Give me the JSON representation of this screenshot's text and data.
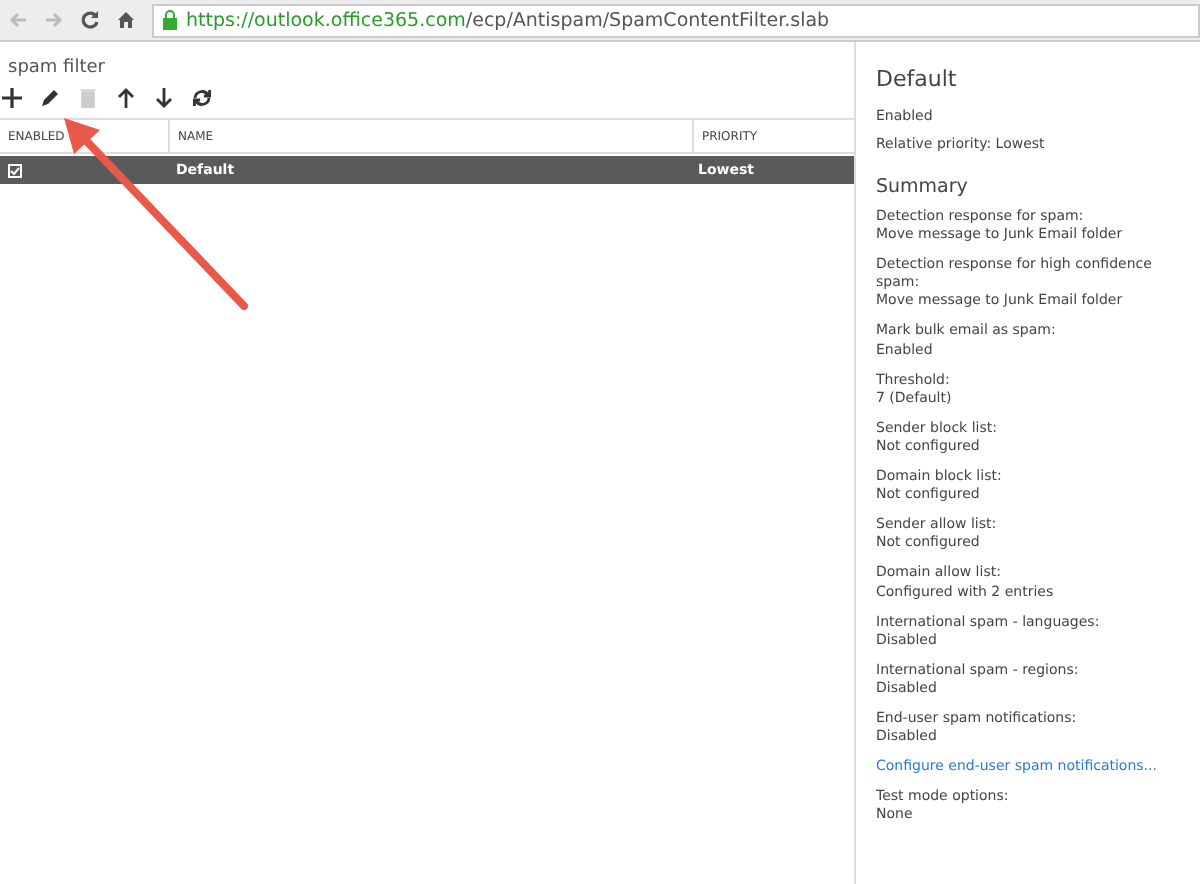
{
  "browser": {
    "url_host": "https://outlook.office365.com",
    "url_path": "/ecp/Antispam/SpamContentFilter.slab"
  },
  "page_title": "spam filter",
  "toolbar": [
    {
      "kind": "add",
      "disabled": false
    },
    {
      "kind": "edit",
      "disabled": false
    },
    {
      "kind": "delete",
      "disabled": true
    },
    {
      "kind": "up",
      "disabled": false
    },
    {
      "kind": "down",
      "disabled": false
    },
    {
      "kind": "refresh",
      "disabled": false
    }
  ],
  "table": {
    "columns": [
      "ENABLED",
      "NAME",
      "PRIORITY"
    ],
    "rows": [
      {
        "enabled": true,
        "name": "Default",
        "priority": "Lowest",
        "selected": true
      }
    ]
  },
  "details": {
    "title": "Default",
    "status": "Enabled",
    "priority": "Relative priority: Lowest",
    "summary_title": "Summary",
    "items": [
      {
        "kind": "field",
        "label": "Detection response for spam:",
        "value": "Move message to Junk Email folder"
      },
      {
        "kind": "field",
        "label": "Detection response for high confidence spam:",
        "value": "Move message to Junk Email folder"
      },
      {
        "kind": "field",
        "label": "Mark bulk email as spam:",
        "value": "Enabled"
      },
      {
        "kind": "field",
        "label": "Threshold:",
        "value": "7 (Default)"
      },
      {
        "kind": "field",
        "label": "Sender block list:",
        "value": "Not configured"
      },
      {
        "kind": "field",
        "label": "Domain block list:",
        "value": "Not configured"
      },
      {
        "kind": "field",
        "label": "Sender allow list:",
        "value": "Not configured"
      },
      {
        "kind": "field",
        "label": "Domain allow list:",
        "value": "Configured with 2 entries"
      },
      {
        "kind": "field",
        "label": "International spam - languages:",
        "value": "Disabled"
      },
      {
        "kind": "field",
        "label": "International spam - regions:",
        "value": "Disabled"
      },
      {
        "kind": "field",
        "label": "End-user spam notifications:",
        "value": "Disabled"
      },
      {
        "kind": "link",
        "label": "Configure end-user spam notifications..."
      },
      {
        "kind": "field",
        "label": "Test mode options:",
        "value": "None"
      }
    ]
  }
}
